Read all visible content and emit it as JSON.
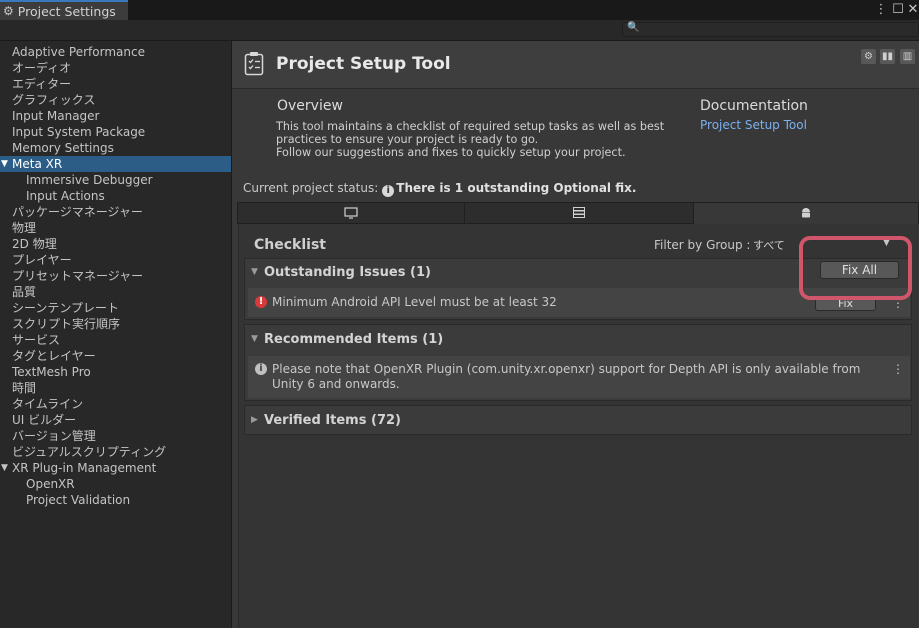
{
  "window": {
    "tab_title": "Project Settings",
    "tab_icon": "gear-icon",
    "menu_icon": "⋮",
    "maximize_icon": "☐",
    "close_icon": "✕"
  },
  "search": {
    "icon": "🔍",
    "placeholder": ""
  },
  "sidebar": {
    "items": [
      {
        "label": "Adaptive Performance"
      },
      {
        "label": "オーディオ"
      },
      {
        "label": "エディター"
      },
      {
        "label": "グラフィックス"
      },
      {
        "label": "Input Manager"
      },
      {
        "label": "Input System Package"
      },
      {
        "label": "Memory Settings"
      },
      {
        "label": "Meta XR"
      },
      {
        "label": "Immersive Debugger"
      },
      {
        "label": "Input Actions"
      },
      {
        "label": "パッケージマネージャー"
      },
      {
        "label": "物理"
      },
      {
        "label": "2D 物理"
      },
      {
        "label": "プレイヤー"
      },
      {
        "label": "プリセットマネージャー"
      },
      {
        "label": "品質"
      },
      {
        "label": "シーンテンプレート"
      },
      {
        "label": "スクリプト実行順序"
      },
      {
        "label": "サービス"
      },
      {
        "label": "タグとレイヤー"
      },
      {
        "label": "TextMesh Pro"
      },
      {
        "label": "時間"
      },
      {
        "label": "タイムライン"
      },
      {
        "label": "UI ビルダー"
      },
      {
        "label": "バージョン管理"
      },
      {
        "label": "ビジュアルスクリプティング"
      },
      {
        "label": "XR Plug-in Management"
      },
      {
        "label": "OpenXR"
      },
      {
        "label": "Project Validation"
      }
    ]
  },
  "header": {
    "title": "Project Setup Tool",
    "icon": "clipboard-checklist-icon"
  },
  "overview": {
    "title": "Overview",
    "line1": "This tool maintains a checklist of required setup tasks as well as best",
    "line2": "practices to ensure your project is ready to go.",
    "line3": "Follow our suggestions and fixes to quickly setup your project."
  },
  "documentation": {
    "title": "Documentation",
    "link": "Project Setup Tool"
  },
  "status": {
    "label": "Current project status:",
    "value": "There is 1 outstanding Optional fix."
  },
  "platform_tabs": [
    {
      "icon": "monitor-icon",
      "glyph": "🖵"
    },
    {
      "icon": "server-icon",
      "glyph": "☷"
    },
    {
      "icon": "android-icon",
      "glyph": "🤖"
    }
  ],
  "checklist": {
    "title": "Checklist",
    "filter_label": "Filter by Group :",
    "filter_value": "すべて",
    "fix_all_label": "Fix All",
    "groups": {
      "outstanding": {
        "title": "Outstanding Issues (1)",
        "items": [
          {
            "text": "Minimum Android API Level must be at least 32",
            "fix_label": "Fix"
          }
        ]
      },
      "recommended": {
        "title": "Recommended Items (1)",
        "items": [
          {
            "line1": "Please note that OpenXR Plugin (com.unity.xr.openxr) support for Depth API is only available from",
            "line2": "Unity 6 and onwards."
          }
        ]
      },
      "verified": {
        "title": "Verified Items (72)"
      }
    }
  },
  "colors": {
    "selection": "#2c5d87",
    "link": "#7cb0f0",
    "error": "#d83a3a",
    "highlight": "#d2566b"
  }
}
